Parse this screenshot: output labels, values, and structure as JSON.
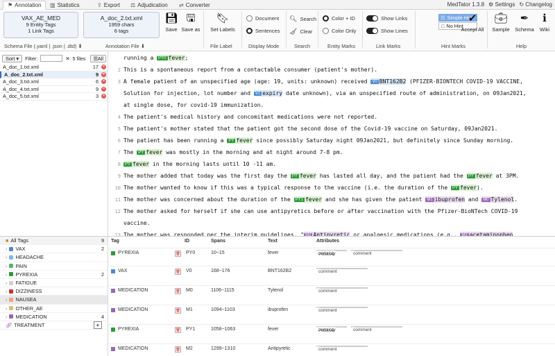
{
  "tabs": [
    {
      "label": "Annotation",
      "icon": "tag-icon",
      "active": true
    },
    {
      "label": "Statistics",
      "icon": "chart-icon"
    },
    {
      "label": "Export",
      "icon": "export-icon"
    },
    {
      "label": "Adjudication",
      "icon": "scale-icon"
    },
    {
      "label": "Converter",
      "icon": "convert-icon"
    }
  ],
  "brand": {
    "name": "MedTator 1.3.8",
    "settings": "Settings",
    "changelog": "Changelog"
  },
  "schema_box": {
    "title": "VAX_AE_MED",
    "line2": "9 Entity Tags",
    "line3": "1 Link Tags",
    "caption": "Schema File (.yaml | .json | .dtd)"
  },
  "annotation_box": {
    "title": "A_doc_2.txt.xml",
    "line2": "1959 chars",
    "line3": "6 tags",
    "caption": "Annotation File"
  },
  "file_buttons": {
    "save": "Save",
    "save_as": "Save as"
  },
  "file_label": {
    "button": "Set Labels",
    "caption": "File Label"
  },
  "display_mode": {
    "document": "Document",
    "sentences": "Sentences",
    "caption": "Display Mode"
  },
  "search": {
    "search": "Search",
    "clear": "Clear",
    "caption": "Search"
  },
  "entity_marks": {
    "color_id": "Color + ID",
    "color_only": "Color Only",
    "caption": "Entity Marks"
  },
  "link_marks": {
    "show_links": "Show Links",
    "show_lines": "Show Lines",
    "caption": "Link Marks"
  },
  "hint_marks": {
    "simple": "Simple Hint",
    "no_hint": "No Hint",
    "accept_all": "Accept All",
    "caption": "Hint Marks"
  },
  "help": {
    "sample": "Sample",
    "schema": "Schema",
    "wiki": "Wiki",
    "caption": "Help"
  },
  "file_list": {
    "sort": "Sort",
    "filter_label": "Filter:",
    "count": "5 files",
    "all": "All",
    "files": [
      {
        "name": "A_doc_1.txt.xml",
        "count": "17"
      },
      {
        "name": "A_doc_2.txt.xml",
        "count": "9",
        "selected": true
      },
      {
        "name": "A_doc_3.txt.xml",
        "count": "6"
      },
      {
        "name": "A_doc_4.txt.xml",
        "count": "9"
      },
      {
        "name": "A_doc_5.txt.xml",
        "count": "3"
      }
    ]
  },
  "sentences": [
    {
      "n": "",
      "parts": [
        {
          "t": "running a "
        },
        {
          "e": "py",
          "k": "PY0",
          "t": "fever"
        },
        {
          "t": ";"
        }
      ]
    },
    {
      "n": "2",
      "parts": [
        {
          "t": "This is a spontaneous report from a contactable consumer (patient's mother)."
        }
      ]
    },
    {
      "n": "3",
      "parts": [
        {
          "t": "A female patient of an unspecified age (age: 19, units: unknown) received "
        },
        {
          "e": "vax",
          "k": "V0",
          "t": "BNT162B2"
        },
        {
          "t": " (PFIZER-BIONTECH COVID-19 VACCINE,"
        }
      ]
    },
    {
      "n": "",
      "parts": [
        {
          "t": "Solution for injection, lot number and "
        },
        {
          "e": "vax",
          "k": "V1",
          "t": "expiry"
        },
        {
          "t": " date unknown), via an unspecified route of administration, on 09Jan2021,"
        }
      ]
    },
    {
      "n": "",
      "parts": [
        {
          "t": "at single dose, for covid-19 immunization."
        }
      ]
    },
    {
      "n": "4",
      "parts": [
        {
          "t": "The patient's medical history and concomitant medications were not reported."
        }
      ]
    },
    {
      "n": "5",
      "parts": [
        {
          "t": "The patient's mother stated that the patient got the second dose of the Covid-19 vaccine on Saturday, 09Jan2021."
        }
      ]
    },
    {
      "n": "6",
      "parts": [
        {
          "t": "The patient has been running a "
        },
        {
          "e": "py",
          "k": "PY",
          "t": "fever"
        },
        {
          "t": " since possibly Saturday night 09Jan2021, but definitely since Sunday morning."
        }
      ]
    },
    {
      "n": "7",
      "parts": [
        {
          "t": "The "
        },
        {
          "e": "py",
          "k": "PY",
          "t": "fever"
        },
        {
          "t": " was mostly in the morning and at night around 7-8 pm."
        }
      ]
    },
    {
      "n": "8",
      "parts": [
        {
          "e": "py",
          "k": "PY",
          "t": "fever"
        },
        {
          "t": " in the morning lasts until 10 -11 am."
        }
      ]
    },
    {
      "n": "9",
      "parts": [
        {
          "t": "The mother added that today was the first day the "
        },
        {
          "e": "py",
          "k": "PY",
          "t": "fever"
        },
        {
          "t": " has lasted all day, and the patient had the "
        },
        {
          "e": "py",
          "k": "PY",
          "t": "fever"
        },
        {
          "t": " at 3PM."
        }
      ]
    },
    {
      "n": "10",
      "parts": [
        {
          "t": "The mother wanted to know if this was a typical response to the vaccine (i.e. the duration of the "
        },
        {
          "e": "py",
          "k": "PY",
          "t": "fever"
        },
        {
          "t": ")."
        }
      ]
    },
    {
      "n": "11",
      "parts": [
        {
          "t": "The mother was concerned about the duration of the "
        },
        {
          "e": "py",
          "k": "PY1",
          "t": "fever"
        },
        {
          "t": " and she has given the patient "
        },
        {
          "e": "med",
          "k": "M1",
          "t": "ibuprofen"
        },
        {
          "t": " and "
        },
        {
          "e": "med",
          "k": "M0",
          "t": "Tylenol"
        },
        {
          "t": "."
        }
      ]
    },
    {
      "n": "12",
      "parts": [
        {
          "t": "The mother asked for herself if she can use antipyretics before or after vaccination with the Pfizer-BioNTech COVID-19"
        }
      ]
    },
    {
      "n": "",
      "parts": [
        {
          "t": "vaccine."
        }
      ]
    },
    {
      "n": "13",
      "parts": [
        {
          "t": "The mother was responded per the interim guidelines, \""
        },
        {
          "e": "med",
          "k": "M2",
          "t": "Antipyretic"
        },
        {
          "t": " or analgesic medications (e.g., "
        },
        {
          "e": "med",
          "k": "M3",
          "t": "acetaminophen"
        }
      ]
    }
  ],
  "tag_list": {
    "all": {
      "label": "All Tags",
      "count": "9"
    },
    "tags": [
      {
        "name": "VAX",
        "count": "2",
        "color": "#4a8ad4"
      },
      {
        "name": "HEADACHE",
        "count": "",
        "color": "#7fb7e8"
      },
      {
        "name": "PAIN",
        "count": "",
        "color": "#5ab56a"
      },
      {
        "name": "PYREXIA",
        "count": "2",
        "color": "#2e9a3a"
      },
      {
        "name": "FATIGUE",
        "count": "",
        "color": "#d0d0d0"
      },
      {
        "name": "DIZZINESS",
        "count": "",
        "color": "#cc3333"
      },
      {
        "name": "NAUSEA",
        "count": "",
        "color": "#e8a87c",
        "selected": true
      },
      {
        "name": "OTHER_AE",
        "count": "",
        "color": "#d8c078"
      },
      {
        "name": "MEDICATION",
        "count": "4",
        "color": "#9a66b4"
      }
    ],
    "link": {
      "name": "TREATMENT",
      "add": "+"
    }
  },
  "ann_table": {
    "headers": {
      "tag": "Tag",
      "id": "ID",
      "spans": "Spans",
      "text": "Text",
      "attributes": "Attributes"
    },
    "rows": [
      {
        "tag": "PYREXIA",
        "color": "#2e9a3a",
        "id": "PY0",
        "spans": "10~15",
        "text": "fever",
        "attrs": [
          {
            "label": "certainty",
            "value": "Positive"
          },
          {
            "label": "comment",
            "value": ""
          }
        ]
      },
      {
        "tag": "VAX",
        "color": "#4a8ad4",
        "id": "V0",
        "spans": "168~176",
        "text": "BNT162B2",
        "attrs": [
          {
            "label": "comment",
            "value": ""
          }
        ]
      },
      {
        "tag": "MEDICATION",
        "color": "#9a66b4",
        "id": "M0",
        "spans": "1106~1115",
        "text": "Tylenol",
        "attrs": [
          {
            "label": "comment",
            "value": ""
          }
        ]
      },
      {
        "tag": "MEDICATION",
        "color": "#9a66b4",
        "id": "M1",
        "spans": "1094~1103",
        "text": "ibuprofen",
        "attrs": [
          {
            "label": "comment",
            "value": ""
          }
        ]
      },
      {
        "tag": "PYREXIA",
        "color": "#2e9a3a",
        "id": "PY1",
        "spans": "1058~1063",
        "text": "fever",
        "attrs": [
          {
            "label": "certainty",
            "value": "Positive"
          },
          {
            "label": "comment",
            "value": ""
          }
        ]
      },
      {
        "tag": "MEDICATION",
        "color": "#9a66b4",
        "id": "M2",
        "spans": "1299~1310",
        "text": "Antipyretic",
        "attrs": [
          {
            "label": "comment",
            "value": ""
          }
        ]
      }
    ]
  }
}
